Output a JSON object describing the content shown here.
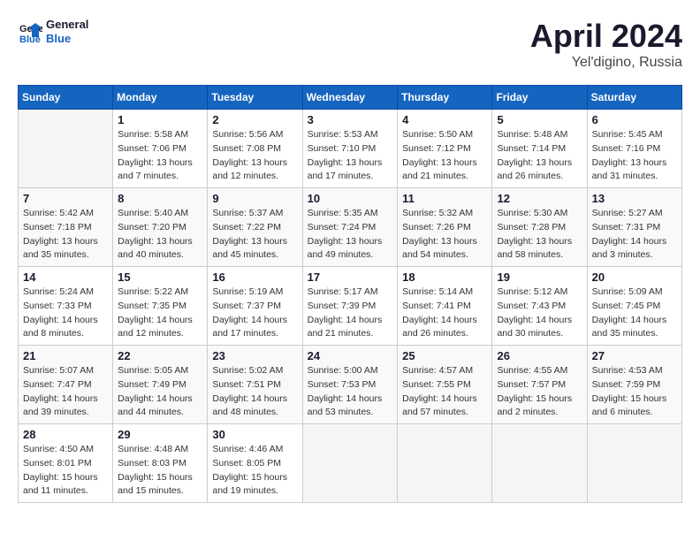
{
  "logo": {
    "line1": "General",
    "line2": "Blue"
  },
  "title": "April 2024",
  "location": "Yel'digino, Russia",
  "weekdays": [
    "Sunday",
    "Monday",
    "Tuesday",
    "Wednesday",
    "Thursday",
    "Friday",
    "Saturday"
  ],
  "weeks": [
    [
      {
        "day": "",
        "info": ""
      },
      {
        "day": "1",
        "info": "Sunrise: 5:58 AM\nSunset: 7:06 PM\nDaylight: 13 hours\nand 7 minutes."
      },
      {
        "day": "2",
        "info": "Sunrise: 5:56 AM\nSunset: 7:08 PM\nDaylight: 13 hours\nand 12 minutes."
      },
      {
        "day": "3",
        "info": "Sunrise: 5:53 AM\nSunset: 7:10 PM\nDaylight: 13 hours\nand 17 minutes."
      },
      {
        "day": "4",
        "info": "Sunrise: 5:50 AM\nSunset: 7:12 PM\nDaylight: 13 hours\nand 21 minutes."
      },
      {
        "day": "5",
        "info": "Sunrise: 5:48 AM\nSunset: 7:14 PM\nDaylight: 13 hours\nand 26 minutes."
      },
      {
        "day": "6",
        "info": "Sunrise: 5:45 AM\nSunset: 7:16 PM\nDaylight: 13 hours\nand 31 minutes."
      }
    ],
    [
      {
        "day": "7",
        "info": "Sunrise: 5:42 AM\nSunset: 7:18 PM\nDaylight: 13 hours\nand 35 minutes."
      },
      {
        "day": "8",
        "info": "Sunrise: 5:40 AM\nSunset: 7:20 PM\nDaylight: 13 hours\nand 40 minutes."
      },
      {
        "day": "9",
        "info": "Sunrise: 5:37 AM\nSunset: 7:22 PM\nDaylight: 13 hours\nand 45 minutes."
      },
      {
        "day": "10",
        "info": "Sunrise: 5:35 AM\nSunset: 7:24 PM\nDaylight: 13 hours\nand 49 minutes."
      },
      {
        "day": "11",
        "info": "Sunrise: 5:32 AM\nSunset: 7:26 PM\nDaylight: 13 hours\nand 54 minutes."
      },
      {
        "day": "12",
        "info": "Sunrise: 5:30 AM\nSunset: 7:28 PM\nDaylight: 13 hours\nand 58 minutes."
      },
      {
        "day": "13",
        "info": "Sunrise: 5:27 AM\nSunset: 7:31 PM\nDaylight: 14 hours\nand 3 minutes."
      }
    ],
    [
      {
        "day": "14",
        "info": "Sunrise: 5:24 AM\nSunset: 7:33 PM\nDaylight: 14 hours\nand 8 minutes."
      },
      {
        "day": "15",
        "info": "Sunrise: 5:22 AM\nSunset: 7:35 PM\nDaylight: 14 hours\nand 12 minutes."
      },
      {
        "day": "16",
        "info": "Sunrise: 5:19 AM\nSunset: 7:37 PM\nDaylight: 14 hours\nand 17 minutes."
      },
      {
        "day": "17",
        "info": "Sunrise: 5:17 AM\nSunset: 7:39 PM\nDaylight: 14 hours\nand 21 minutes."
      },
      {
        "day": "18",
        "info": "Sunrise: 5:14 AM\nSunset: 7:41 PM\nDaylight: 14 hours\nand 26 minutes."
      },
      {
        "day": "19",
        "info": "Sunrise: 5:12 AM\nSunset: 7:43 PM\nDaylight: 14 hours\nand 30 minutes."
      },
      {
        "day": "20",
        "info": "Sunrise: 5:09 AM\nSunset: 7:45 PM\nDaylight: 14 hours\nand 35 minutes."
      }
    ],
    [
      {
        "day": "21",
        "info": "Sunrise: 5:07 AM\nSunset: 7:47 PM\nDaylight: 14 hours\nand 39 minutes."
      },
      {
        "day": "22",
        "info": "Sunrise: 5:05 AM\nSunset: 7:49 PM\nDaylight: 14 hours\nand 44 minutes."
      },
      {
        "day": "23",
        "info": "Sunrise: 5:02 AM\nSunset: 7:51 PM\nDaylight: 14 hours\nand 48 minutes."
      },
      {
        "day": "24",
        "info": "Sunrise: 5:00 AM\nSunset: 7:53 PM\nDaylight: 14 hours\nand 53 minutes."
      },
      {
        "day": "25",
        "info": "Sunrise: 4:57 AM\nSunset: 7:55 PM\nDaylight: 14 hours\nand 57 minutes."
      },
      {
        "day": "26",
        "info": "Sunrise: 4:55 AM\nSunset: 7:57 PM\nDaylight: 15 hours\nand 2 minutes."
      },
      {
        "day": "27",
        "info": "Sunrise: 4:53 AM\nSunset: 7:59 PM\nDaylight: 15 hours\nand 6 minutes."
      }
    ],
    [
      {
        "day": "28",
        "info": "Sunrise: 4:50 AM\nSunset: 8:01 PM\nDaylight: 15 hours\nand 11 minutes."
      },
      {
        "day": "29",
        "info": "Sunrise: 4:48 AM\nSunset: 8:03 PM\nDaylight: 15 hours\nand 15 minutes."
      },
      {
        "day": "30",
        "info": "Sunrise: 4:46 AM\nSunset: 8:05 PM\nDaylight: 15 hours\nand 19 minutes."
      },
      {
        "day": "",
        "info": ""
      },
      {
        "day": "",
        "info": ""
      },
      {
        "day": "",
        "info": ""
      },
      {
        "day": "",
        "info": ""
      }
    ]
  ]
}
